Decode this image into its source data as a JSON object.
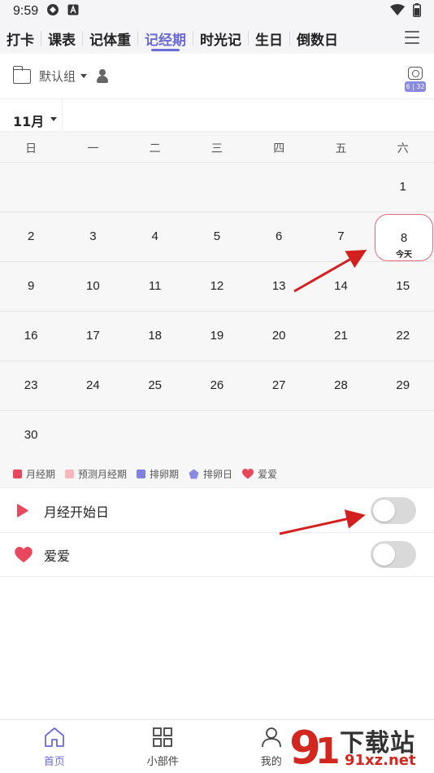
{
  "status_bar": {
    "time": "9:59"
  },
  "tabs": [
    {
      "label": "打卡",
      "active": false
    },
    {
      "label": "课表",
      "active": false
    },
    {
      "label": "记体重",
      "active": false
    },
    {
      "label": "记经期",
      "active": true
    },
    {
      "label": "时光记",
      "active": false
    },
    {
      "label": "生日",
      "active": false
    },
    {
      "label": "倒数日",
      "active": false
    }
  ],
  "group": {
    "name": "默认组",
    "badge": "6 | 32"
  },
  "calendar": {
    "month": "11月",
    "weekdays": [
      "日",
      "一",
      "二",
      "三",
      "四",
      "五",
      "六"
    ],
    "weeks": [
      [
        "",
        "",
        "",
        "",
        "",
        "",
        "1"
      ],
      [
        "2",
        "3",
        "4",
        "5",
        "6",
        "7",
        "8"
      ],
      [
        "9",
        "10",
        "11",
        "12",
        "13",
        "14",
        "15"
      ],
      [
        "16",
        "17",
        "18",
        "19",
        "20",
        "21",
        "22"
      ],
      [
        "23",
        "24",
        "25",
        "26",
        "27",
        "28",
        "29"
      ],
      [
        "30",
        "",
        "",
        "",
        "",
        "",
        ""
      ]
    ],
    "today": {
      "day": "8",
      "label": "今天"
    }
  },
  "legend": [
    {
      "label": "月经期",
      "color": "#e8485e",
      "shape": "square"
    },
    {
      "label": "预测月经期",
      "color": "#f6b7bf",
      "shape": "square"
    },
    {
      "label": "排卵期",
      "color": "#8080e0",
      "shape": "square"
    },
    {
      "label": "排卵日",
      "color": "#8a8ae0",
      "shape": "pentagon"
    },
    {
      "label": "爱爱",
      "color": "#e8485e",
      "shape": "heart"
    }
  ],
  "rows": {
    "period_start": {
      "label": "月经开始日",
      "on": false
    },
    "love": {
      "label": "爱爱",
      "on": false
    }
  },
  "bottom_nav": [
    {
      "label": "首页",
      "icon": "home-icon",
      "active": true
    },
    {
      "label": "小部件",
      "icon": "widgets-icon",
      "active": false
    },
    {
      "label": "我的",
      "icon": "profile-icon",
      "active": false
    }
  ],
  "watermark": {
    "text": "下载站",
    "url": "91xz.net"
  },
  "colors": {
    "accent": "#6b6bd6",
    "today_ring": "#e46a7a",
    "period": "#e8485e",
    "arrow": "#d41f1f"
  }
}
